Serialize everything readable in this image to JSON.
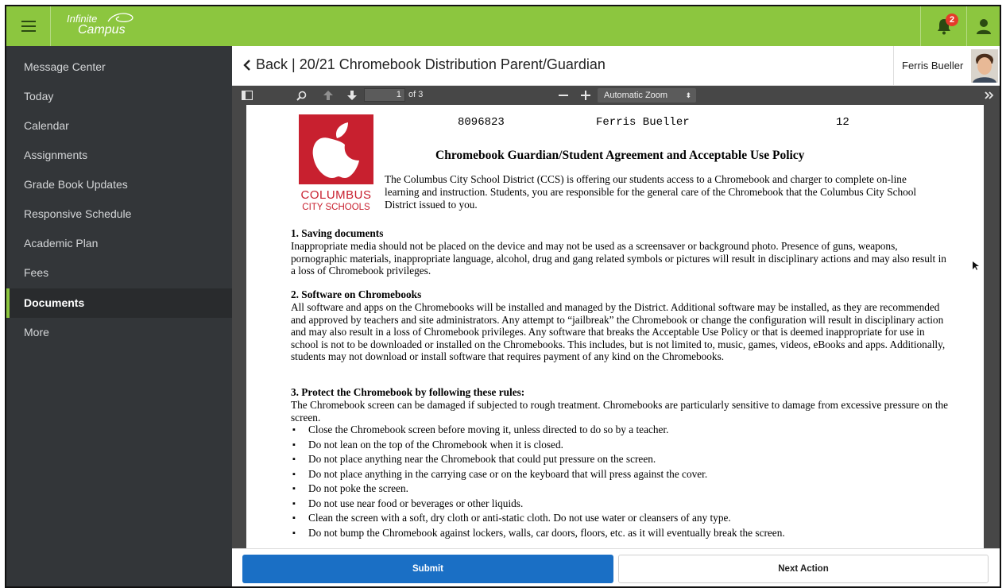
{
  "app": {
    "logo_line1": "Infinite",
    "logo_line2": "Campus",
    "notification_count": "2",
    "brand_color": "#8cc63f"
  },
  "sidebar": {
    "items": [
      {
        "label": "Message Center"
      },
      {
        "label": "Today"
      },
      {
        "label": "Calendar"
      },
      {
        "label": "Assignments"
      },
      {
        "label": "Grade Book Updates"
      },
      {
        "label": "Responsive Schedule"
      },
      {
        "label": "Academic Plan"
      },
      {
        "label": "Fees"
      },
      {
        "label": "Documents",
        "active": true
      },
      {
        "label": "More"
      }
    ]
  },
  "header": {
    "back_title": "Back | 20/21 Chromebook Distribution Parent/Guardian",
    "user_name": "Ferris Bueller"
  },
  "pdf_toolbar": {
    "page_current": "1",
    "page_total": "of 3",
    "zoom": "Automatic Zoom"
  },
  "document": {
    "logo_text1": "COLUMBUS",
    "logo_text2": "CITY SCHOOLS",
    "student_id": "8096823",
    "student_name": "Ferris Bueller",
    "grade": "12",
    "title": "Chromebook Guardian/Student Agreement and Acceptable Use Policy",
    "intro": "The Columbus City School District (CCS) is offering our students access to a Chromebook and charger to complete on-line learning and instruction. Students, you are responsible for the general care of the Chromebook that the Columbus City School District issued to you.",
    "sections": [
      {
        "heading": "1. Saving documents",
        "body": "Inappropriate media should not be placed on the device and may not be used as a screensaver or background photo. Presence of guns, weapons, pornographic materials, inappropriate language, alcohol, drug and gang related symbols or pictures will result in disciplinary actions and may also result in a loss of Chromebook privileges."
      },
      {
        "heading": "2. Software on Chromebooks",
        "body": "All software and apps on the Chromebooks will be installed and managed by the District. Additional software may be installed, as they are recommended and approved by teachers and site administrators. Any attempt to “jailbreak” the Chromebook or change the configuration will result in disciplinary action and may also result in a loss of Chromebook privileges.  Any software that breaks the Acceptable Use Policy or that is deemed inappropriate for use in school is not to be downloaded or installed on the Chromebooks. This includes, but is not limited to, music, games, videos, eBooks and apps.  Additionally, students may not download or install software that requires payment of any kind on the Chromebooks."
      },
      {
        "heading": "3. Protect the Chromebook by following these rules:",
        "body": "The Chromebook screen can be damaged if subjected to rough treatment. Chromebooks are particularly sensitive to damage from excessive pressure on the screen."
      }
    ],
    "bullets": [
      "Close the Chromebook screen before moving it, unless directed to do so by a teacher.",
      "Do not lean on the top of the Chromebook when it is closed.",
      "Do not place anything near the Chromebook that could put pressure on the screen.",
      "Do not place anything in the carrying case or on the keyboard that will press against the cover.",
      "Do not poke the screen.",
      "Do not use near food or beverages or other liquids.",
      "Clean the screen with a soft, dry cloth or anti-static cloth. Do not use water or cleansers of any type.",
      "Do not bump the Chromebook against lockers, walls, car doors, floors, etc. as it will eventually break the screen."
    ]
  },
  "actions": {
    "submit_label": "Submit",
    "next_label": "Next Action",
    "submit_color": "#1a6fc5"
  }
}
